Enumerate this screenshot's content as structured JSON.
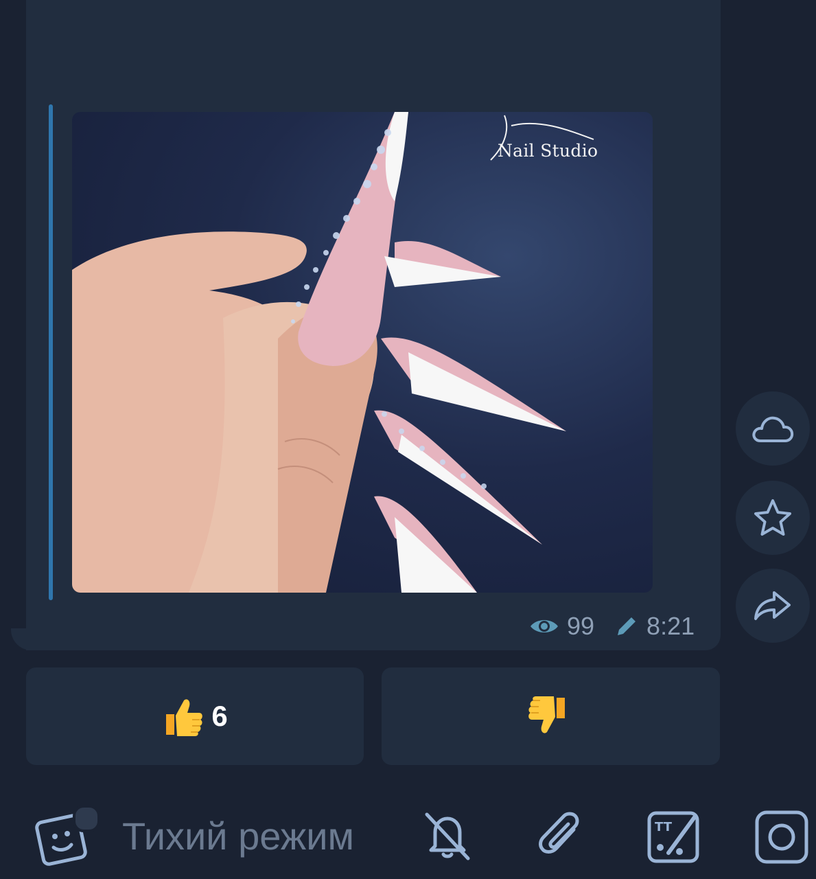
{
  "post": {
    "watermark_text": "Nail Studio",
    "views": "99",
    "time": "8:21"
  },
  "reactions": [
    {
      "emoji": "thumbs-up",
      "count": "6"
    },
    {
      "emoji": "thumbs-down",
      "count": ""
    }
  ],
  "side_actions": [
    "cloud-icon",
    "star-icon",
    "share-icon"
  ],
  "input_bar": {
    "placeholder": "Тихий режим",
    "icons": [
      "sticker-icon",
      "bell-off-icon",
      "paperclip-icon",
      "text-draw-icon",
      "camera-icon"
    ]
  },
  "colors": {
    "background": "#1a2232",
    "bubble": "#212d3f",
    "accent": "#2f76ad",
    "meta_text": "#8fa0b6",
    "icon": "#9ab4d6"
  }
}
